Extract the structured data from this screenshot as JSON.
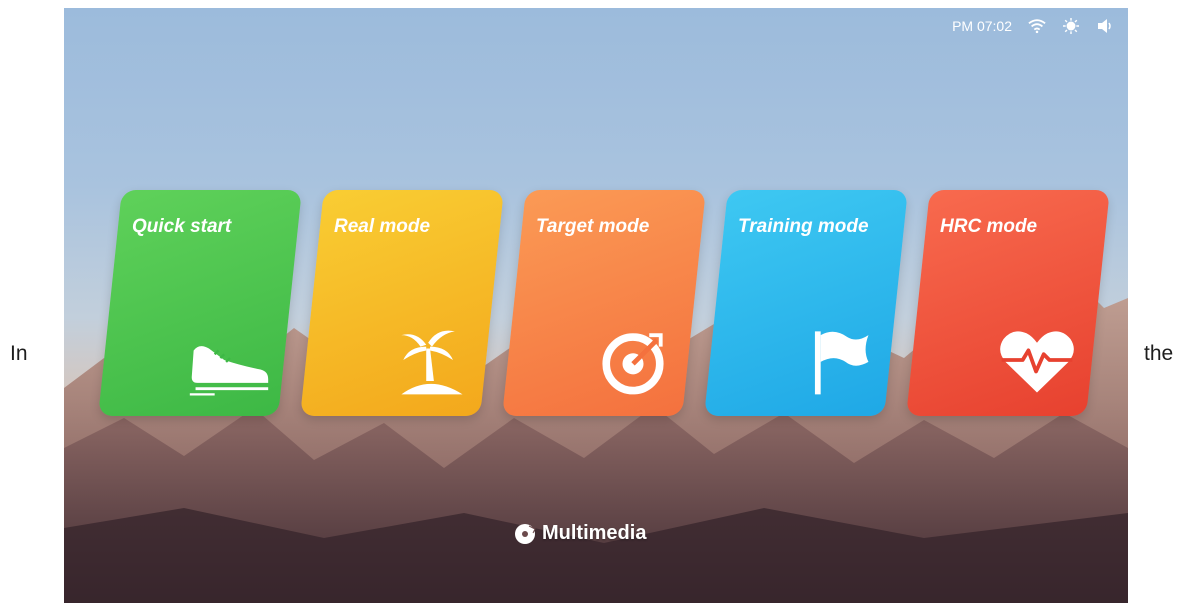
{
  "side_text": {
    "left": "In",
    "right": "the"
  },
  "status_bar": {
    "time": "PM 07:02",
    "icons": [
      "wifi-icon",
      "brightness-icon",
      "volume-icon"
    ]
  },
  "modes": [
    {
      "label": "Quick start",
      "icon": "shoe-icon",
      "color": "#45c14b"
    },
    {
      "label": "Real mode",
      "icon": "palm-tree-icon",
      "color": "#f6b826"
    },
    {
      "label": "Target mode",
      "icon": "target-icon",
      "color": "#f7844a"
    },
    {
      "label": "Training mode",
      "icon": "flag-icon",
      "color": "#2bb6ec"
    },
    {
      "label": "HRC mode",
      "icon": "heart-rate-icon",
      "color": "#ee523b"
    }
  ],
  "multimedia": {
    "label": "Multimedia",
    "icon": "multimedia-icon"
  }
}
